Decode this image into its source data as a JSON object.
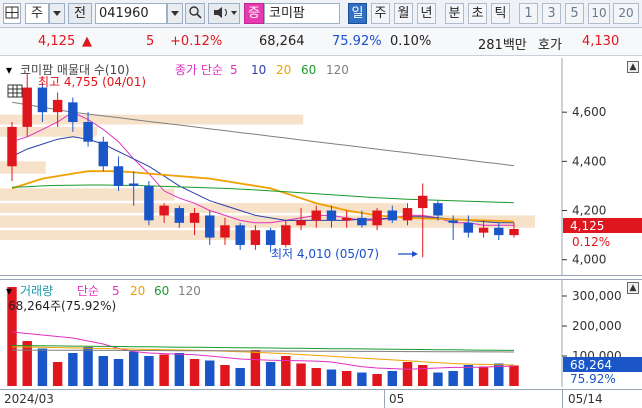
{
  "toolbar": {
    "market": "주",
    "chart_mode": "전",
    "stock_code": "041960",
    "stock_type_badge": "증",
    "stock_name": "코미팜",
    "periods": [
      {
        "label": "일",
        "active": true
      },
      {
        "label": "주",
        "active": false
      },
      {
        "label": "월",
        "active": false
      },
      {
        "label": "년",
        "active": false
      },
      {
        "label": "분",
        "active": false
      },
      {
        "label": "초",
        "active": false
      },
      {
        "label": "틱",
        "active": false
      },
      {
        "label": "1",
        "active": false
      },
      {
        "label": "3",
        "active": false
      },
      {
        "label": "5",
        "active": false
      },
      {
        "label": "10",
        "active": false
      },
      {
        "label": "20",
        "active": false
      }
    ]
  },
  "quote": {
    "price": "4,125",
    "direction": "▲",
    "change": "5",
    "change_pct": "+0.12%",
    "volume": "68,264",
    "volume_ratio": "75.92%",
    "turnover": "0.10%",
    "amount": "281백만",
    "ask_label": "호가",
    "ask_price": "4,130"
  },
  "price_panel": {
    "title": "코미팜 매물대 수(10)",
    "ma_label": "종가 단순",
    "ma_periods": [
      "5",
      "10",
      "20",
      "60",
      "120"
    ],
    "high_marker": "최고 4,755 (04/01)",
    "low_marker": "최저 4,010 (05/07)",
    "axis_labels": [
      "4,600",
      "4,400",
      "4,200",
      "4,000"
    ],
    "current_price_tag": "4,125",
    "current_pct_tag": "0.12%"
  },
  "volume_panel": {
    "title": "거래량",
    "ma_label": "단순",
    "ma_periods": [
      "5",
      "20",
      "60",
      "120"
    ],
    "sub_label": "68,264주(75.92%)",
    "axis_labels": [
      "300,000",
      "200,000",
      "100,000"
    ],
    "current_volume_tag": "68,264",
    "current_pct_tag": "75.92%"
  },
  "date_axis": {
    "labels": [
      "2024/03",
      "05",
      "05/14"
    ]
  },
  "colors": {
    "up": "#e0161e",
    "down": "#1a56c8",
    "ma5": "#e030c0",
    "ma10": "#2a3fa8",
    "ma20": "#f0a000",
    "ma60": "#1a9a2a",
    "ma120": "#7f7f7f",
    "volume_profile": "#f6dcc0"
  },
  "chart_data": {
    "type": "candlestick",
    "series": [
      {
        "name": "종가 단순 5",
        "values": [
          4480,
          4500,
          4530,
          4560,
          4600,
          4570,
          4530,
          4480,
          4410,
          4350,
          4280,
          4250,
          4230,
          4200,
          4180,
          4160,
          4150,
          4150,
          4160,
          4170,
          4180,
          4180,
          4170,
          4160,
          4160,
          4170,
          4180,
          4180,
          4170,
          4150,
          4150,
          4140,
          4140,
          4140
        ]
      },
      {
        "name": "종가 단순 10",
        "values": [
          4420,
          4450,
          4470,
          4490,
          4500,
          4490,
          4470,
          4440,
          4410,
          4380,
          4340,
          4300,
          4270,
          4240,
          4220,
          4200,
          4180,
          4170,
          4160,
          4160,
          4160,
          4160,
          4160,
          4165,
          4165,
          4170,
          4175,
          4175,
          4170,
          4165,
          4160,
          4155,
          4150,
          4150
        ]
      },
      {
        "name": "종가 단순 20",
        "values": [
          4290,
          4310,
          4330,
          4340,
          4350,
          4360,
          4360,
          4360,
          4355,
          4350,
          4345,
          4340,
          4335,
          4330,
          4320,
          4310,
          4300,
          4290,
          4270,
          4250,
          4230,
          4215,
          4200,
          4190,
          4180,
          4175,
          4170,
          4168,
          4166,
          4164,
          4162,
          4160,
          4158,
          4155
        ]
      },
      {
        "name": "종가 단순 60",
        "values": [
          4295,
          4297,
          4300,
          4302,
          4303,
          4304,
          4304,
          4303,
          4302,
          4300,
          4298,
          4296,
          4294,
          4292,
          4290,
          4287,
          4284,
          4280,
          4276,
          4272,
          4268,
          4264,
          4260,
          4256,
          4252,
          4249,
          4246,
          4244,
          4242,
          4240,
          4238,
          4236,
          4234,
          4232
        ]
      },
      {
        "name": "종가 단순 120",
        "values": [
          4640,
          4630,
          4620,
          4610,
          4600,
          4592,
          4585,
          4578,
          4570,
          4562,
          4555,
          4548,
          4540,
          4532,
          4525,
          4517,
          4510,
          4502,
          4495,
          4487,
          4480,
          4472,
          4465,
          4457,
          4450,
          4442,
          4435,
          4427,
          4420,
          4412,
          4405,
          4397,
          4390,
          4382
        ]
      }
    ],
    "candles": [
      {
        "o": 4380,
        "h": 4560,
        "l": 4320,
        "c": 4540
      },
      {
        "o": 4540,
        "h": 4755,
        "l": 4500,
        "c": 4700
      },
      {
        "o": 4700,
        "h": 4720,
        "l": 4560,
        "c": 4600
      },
      {
        "o": 4600,
        "h": 4680,
        "l": 4540,
        "c": 4650
      },
      {
        "o": 4640,
        "h": 4660,
        "l": 4520,
        "c": 4560
      },
      {
        "o": 4560,
        "h": 4600,
        "l": 4460,
        "c": 4480
      },
      {
        "o": 4480,
        "h": 4500,
        "l": 4360,
        "c": 4380
      },
      {
        "o": 4380,
        "h": 4420,
        "l": 4280,
        "c": 4300
      },
      {
        "o": 4310,
        "h": 4360,
        "l": 4220,
        "c": 4300
      },
      {
        "o": 4300,
        "h": 4320,
        "l": 4140,
        "c": 4160
      },
      {
        "o": 4180,
        "h": 4230,
        "l": 4150,
        "c": 4220
      },
      {
        "o": 4210,
        "h": 4220,
        "l": 4130,
        "c": 4150
      },
      {
        "o": 4150,
        "h": 4210,
        "l": 4100,
        "c": 4190
      },
      {
        "o": 4180,
        "h": 4200,
        "l": 4060,
        "c": 4090
      },
      {
        "o": 4090,
        "h": 4170,
        "l": 4060,
        "c": 4140
      },
      {
        "o": 4140,
        "h": 4150,
        "l": 4040,
        "c": 4060
      },
      {
        "o": 4060,
        "h": 4140,
        "l": 4040,
        "c": 4120
      },
      {
        "o": 4120,
        "h": 4130,
        "l": 4030,
        "c": 4060
      },
      {
        "o": 4060,
        "h": 4160,
        "l": 4050,
        "c": 4140
      },
      {
        "o": 4140,
        "h": 4210,
        "l": 4120,
        "c": 4160
      },
      {
        "o": 4160,
        "h": 4220,
        "l": 4130,
        "c": 4200
      },
      {
        "o": 4200,
        "h": 4220,
        "l": 4130,
        "c": 4160
      },
      {
        "o": 4160,
        "h": 4200,
        "l": 4130,
        "c": 4170
      },
      {
        "o": 4170,
        "h": 4200,
        "l": 4130,
        "c": 4140
      },
      {
        "o": 4140,
        "h": 4210,
        "l": 4120,
        "c": 4200
      },
      {
        "o": 4200,
        "h": 4220,
        "l": 4150,
        "c": 4160
      },
      {
        "o": 4160,
        "h": 4230,
        "l": 4140,
        "c": 4210
      },
      {
        "o": 4210,
        "h": 4310,
        "l": 4010,
        "c": 4260
      },
      {
        "o": 4230,
        "h": 4240,
        "l": 4160,
        "c": 4180
      },
      {
        "o": 4160,
        "h": 4180,
        "l": 4080,
        "c": 4150
      },
      {
        "o": 4150,
        "h": 4180,
        "l": 4090,
        "c": 4110
      },
      {
        "o": 4110,
        "h": 4160,
        "l": 4090,
        "c": 4130
      },
      {
        "o": 4130,
        "h": 4150,
        "l": 4080,
        "c": 4100
      },
      {
        "o": 4100,
        "h": 4150,
        "l": 4090,
        "c": 4125
      }
    ],
    "volume_profile": [
      {
        "price_low": 4550,
        "price_high": 4590,
        "strength": 0.55
      },
      {
        "price_low": 4500,
        "price_high": 4540,
        "strength": 0.15
      },
      {
        "price_low": 4350,
        "price_high": 4400,
        "strength": 0.05
      },
      {
        "price_low": 4240,
        "price_high": 4290,
        "strength": 0.3
      },
      {
        "price_low": 4190,
        "price_high": 4230,
        "strength": 0.75
      },
      {
        "price_low": 4130,
        "price_high": 4180,
        "strength": 1.0
      },
      {
        "price_low": 4080,
        "price_high": 4120,
        "strength": 0.45
      }
    ],
    "volume": {
      "values": [
        330000,
        150000,
        125000,
        80000,
        110000,
        130000,
        100000,
        90000,
        115000,
        100000,
        105000,
        110000,
        90000,
        85000,
        70000,
        60000,
        120000,
        80000,
        100000,
        75000,
        60000,
        55000,
        50000,
        45000,
        40000,
        50000,
        80000,
        70000,
        45000,
        50000,
        70000,
        65000,
        75000,
        68264
      ],
      "ma5": [
        180000,
        175000,
        170000,
        165000,
        160000,
        150000,
        140000,
        125000,
        115000,
        110000,
        108000,
        106000,
        104000,
        100000,
        95000,
        90000,
        88000,
        86000,
        85000,
        84000,
        83000,
        80000,
        72000,
        64000,
        60000,
        58000,
        56000,
        58000,
        60000,
        62000,
        62000,
        63000,
        65000,
        66000
      ],
      "ma20": [
        130000,
        130000,
        129000,
        128000,
        127000,
        126000,
        125000,
        124000,
        123000,
        122000,
        121000,
        120000,
        119000,
        118000,
        116000,
        114000,
        112000,
        110000,
        108000,
        105000,
        102000,
        99000,
        96000,
        93000,
        90000,
        87000,
        84000,
        81000,
        78000,
        75000,
        73000,
        72000,
        71000,
        70000
      ],
      "ma60": [
        135000,
        134500,
        134000,
        133500,
        133000,
        132500,
        132000,
        131500,
        131000,
        130500,
        130000,
        129500,
        129000,
        128500,
        128000,
        127500,
        127000,
        126500,
        126000,
        125500,
        125000,
        124500,
        124000,
        123500,
        123000,
        122500,
        122000,
        121500,
        121000,
        120500,
        120000,
        119500,
        119000,
        118500
      ],
      "ma120": [
        120000,
        119800,
        119600,
        119400,
        119200,
        119000,
        118800,
        118600,
        118400,
        118200,
        118000,
        117800,
        117600,
        117400,
        117200,
        117000,
        116800,
        116600,
        116400,
        116200,
        116000,
        115800,
        115600,
        115400,
        115200,
        115000,
        114800,
        114600,
        114400,
        114200,
        114000,
        113800,
        113600,
        113400
      ]
    },
    "price_ylim": [
      3950,
      4800
    ],
    "volume_ylim": [
      0,
      350000
    ],
    "grid": false,
    "legend": "top-left"
  }
}
